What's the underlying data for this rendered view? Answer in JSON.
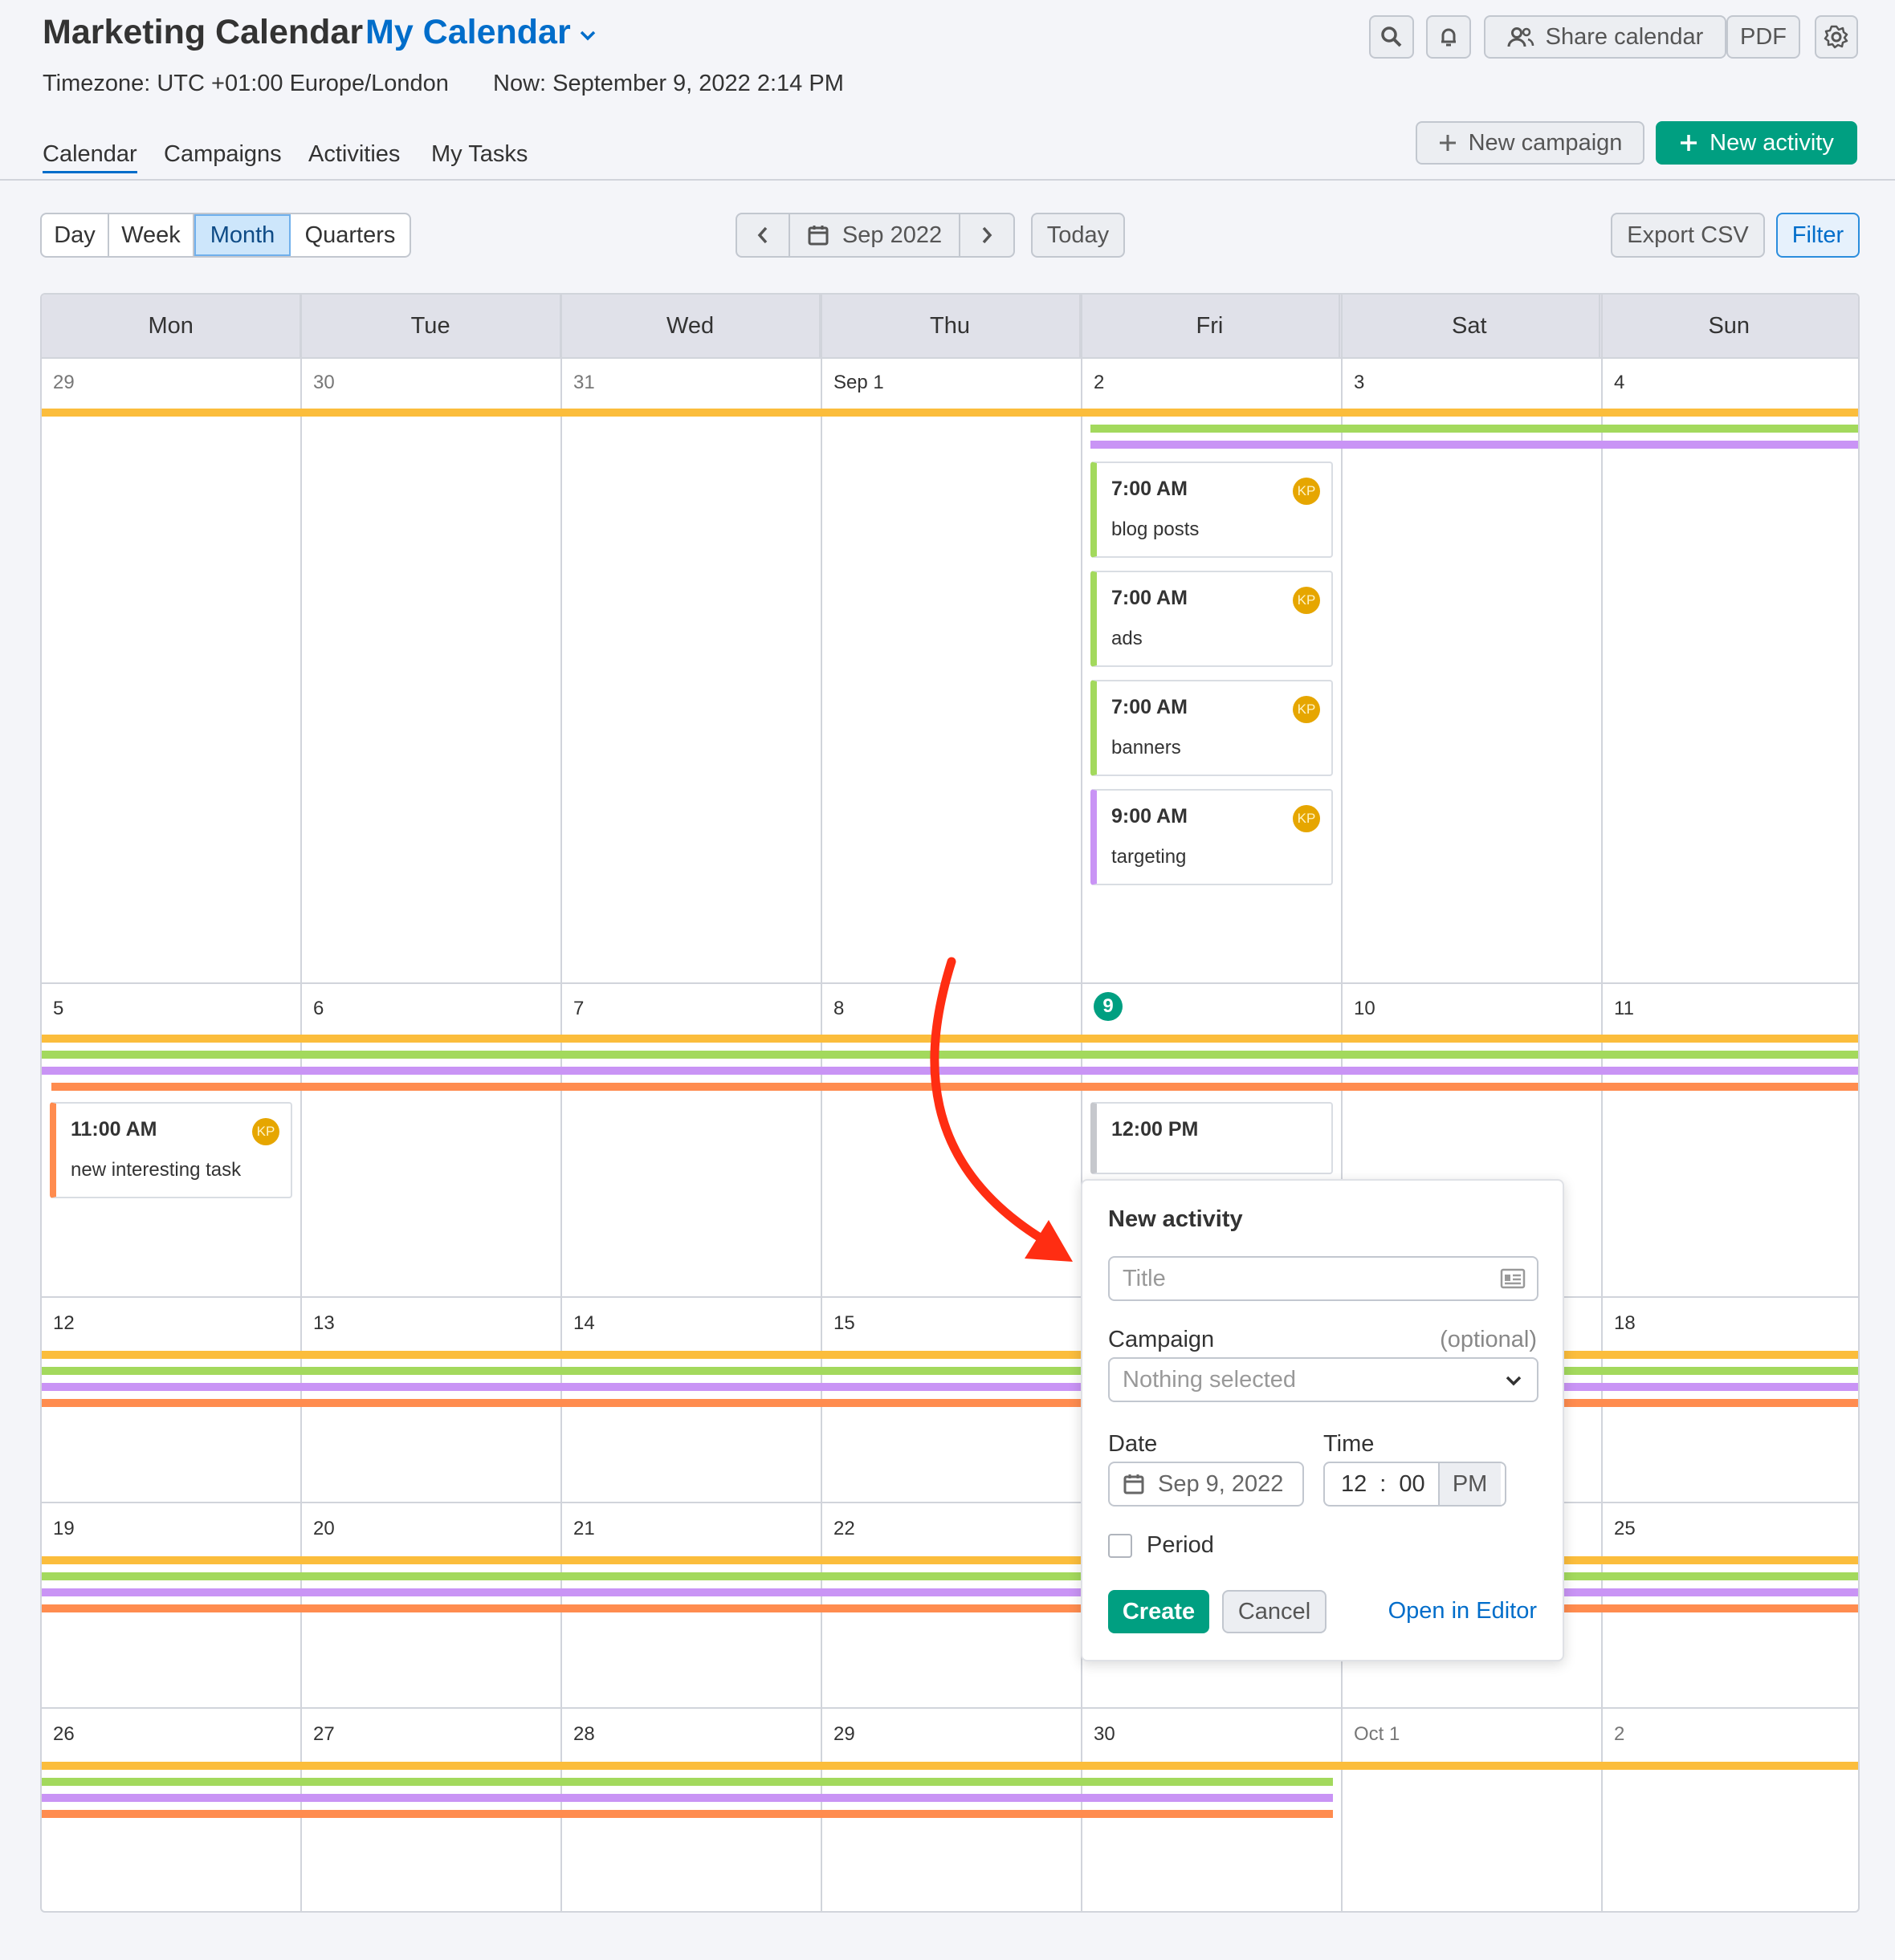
{
  "header": {
    "title": "Marketing Calendar",
    "calendar_name": "My Calendar",
    "timezone": "Timezone: UTC +01:00 Europe/London",
    "now": "Now: September 9, 2022 2:14 PM",
    "share_label": "Share calendar",
    "pdf_label": "PDF"
  },
  "tabs": [
    "Calendar",
    "Campaigns",
    "Activities",
    "My Tasks"
  ],
  "actions": {
    "new_campaign": "New campaign",
    "new_activity": "New activity"
  },
  "views": [
    "Day",
    "Week",
    "Month",
    "Quarters"
  ],
  "selected_view": "Month",
  "period_label": "Sep 2022",
  "today_label": "Today",
  "export_label": "Export CSV",
  "filter_label": "Filter",
  "weekdays": [
    "Mon",
    "Tue",
    "Wed",
    "Thu",
    "Fri",
    "Sat",
    "Sun"
  ],
  "weeks": [
    [
      "29",
      "30",
      "31",
      "Sep 1",
      "2",
      "3",
      "4"
    ],
    [
      "5",
      "6",
      "7",
      "8",
      "9",
      "10",
      "11"
    ],
    [
      "12",
      "13",
      "14",
      "15",
      "",
      "",
      "18"
    ],
    [
      "19",
      "20",
      "21",
      "22",
      "",
      "",
      "25"
    ],
    [
      "26",
      "27",
      "28",
      "29",
      "30",
      "Oct 1",
      "2"
    ]
  ],
  "campaign_colors": {
    "yellow": "#fbbd3c",
    "green": "#a3d95d",
    "purple": "#c994f5",
    "orange": "#ff8c4f",
    "gray": "#c6c8cd"
  },
  "events": {
    "e1": {
      "time": "7:00 AM",
      "name": "blog posts",
      "avatar": "KP",
      "color": "#a3d95d"
    },
    "e2": {
      "time": "7:00 AM",
      "name": "ads",
      "avatar": "KP",
      "color": "#a3d95d"
    },
    "e3": {
      "time": "7:00 AM",
      "name": "banners",
      "avatar": "KP",
      "color": "#a3d95d"
    },
    "e4": {
      "time": "9:00 AM",
      "name": "targeting",
      "avatar": "KP",
      "color": "#c994f5"
    },
    "e5": {
      "time": "11:00 AM",
      "name": "new interesting task",
      "avatar": "KP",
      "color": "#ff8c4f"
    },
    "e6": {
      "time": "12:00 PM",
      "name": "",
      "color": "#c6c8cd"
    }
  },
  "popup": {
    "title": "New activity",
    "title_placeholder": "Title",
    "campaign_label": "Campaign",
    "campaign_optional": "(optional)",
    "campaign_value": "Nothing selected",
    "date_label": "Date",
    "date_value": "Sep 9, 2022",
    "time_label": "Time",
    "hour": "12",
    "colon": ":",
    "minute": "00",
    "ampm": "PM",
    "period_label": "Period",
    "create": "Create",
    "cancel": "Cancel",
    "open_editor": "Open in Editor"
  }
}
